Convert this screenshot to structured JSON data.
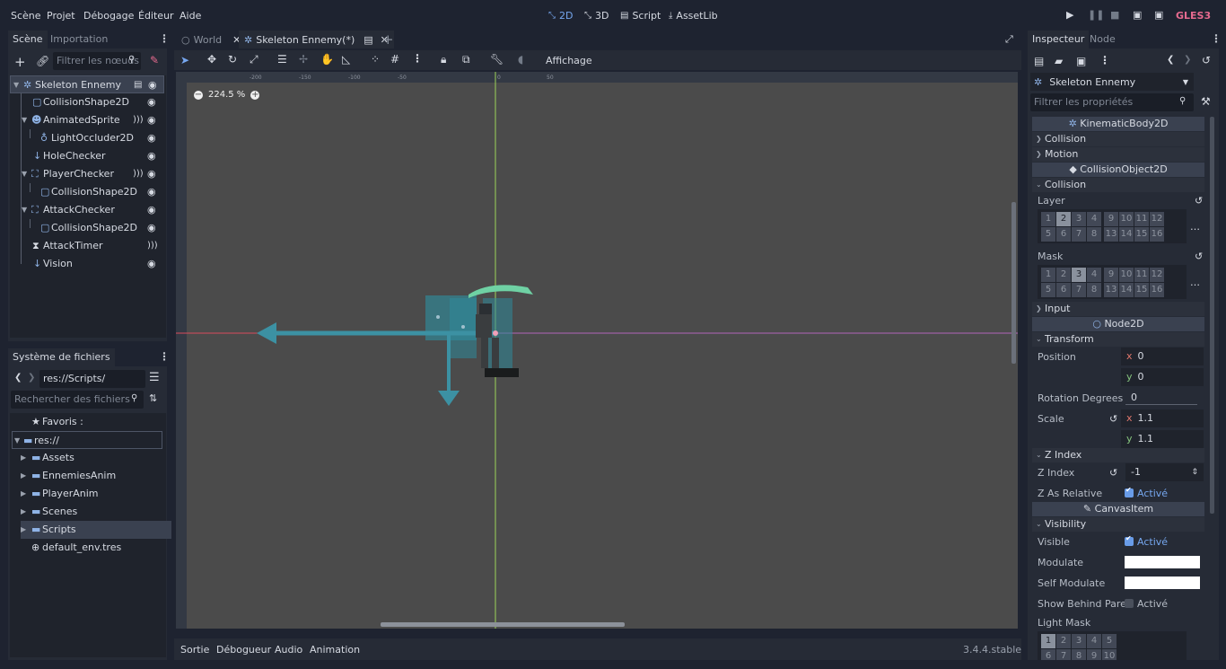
{
  "menubar": {
    "items": [
      "Scène",
      "Projet",
      "Débogage",
      "Éditeur",
      "Aide"
    ],
    "tabs": [
      {
        "label": "2D",
        "icon": "2d-icon",
        "active": true
      },
      {
        "label": "3D",
        "icon": "3d-icon",
        "active": false
      },
      {
        "label": "Script",
        "icon": "script-icon",
        "active": false
      },
      {
        "label": "AssetLib",
        "icon": "assetlib-icon",
        "active": false
      }
    ],
    "renderer": "GLES3"
  },
  "scene_dock": {
    "tabs": [
      "Scène",
      "Importation"
    ],
    "filter_placeholder": "Filtrer les nœuds",
    "nodes": [
      {
        "label": "Skeleton Ennemy",
        "icon": "kinematic-body-icon",
        "depth": 0,
        "selected": true
      },
      {
        "label": "CollisionShape2D",
        "icon": "collision-shape-icon",
        "depth": 1
      },
      {
        "label": "AnimatedSprite",
        "icon": "animated-sprite-icon",
        "depth": 1
      },
      {
        "label": "LightOccluder2D",
        "icon": "light-occluder-icon",
        "depth": 2
      },
      {
        "label": "HoleChecker",
        "icon": "raycast-icon",
        "depth": 1
      },
      {
        "label": "PlayerChecker",
        "icon": "area-icon",
        "depth": 1
      },
      {
        "label": "CollisionShape2D",
        "icon": "collision-shape-icon",
        "depth": 2
      },
      {
        "label": "AttackChecker",
        "icon": "area-icon",
        "depth": 1
      },
      {
        "label": "CollisionShape2D",
        "icon": "collision-shape-icon",
        "depth": 2
      },
      {
        "label": "AttackTimer",
        "icon": "timer-icon",
        "depth": 1
      },
      {
        "label": "Vision",
        "icon": "raycast-icon",
        "depth": 1
      }
    ]
  },
  "filesystem_dock": {
    "title": "Système de fichiers",
    "path": "res://Scripts/",
    "search_placeholder": "Rechercher des fichiers",
    "items": [
      {
        "label": "Favoris :",
        "icon": "star-icon"
      },
      {
        "label": "res://",
        "icon": "folder-icon"
      },
      {
        "label": "Assets",
        "icon": "folder-icon"
      },
      {
        "label": "EnnemiesAnim",
        "icon": "folder-icon"
      },
      {
        "label": "PlayerAnim",
        "icon": "folder-icon"
      },
      {
        "label": "Scenes",
        "icon": "folder-icon"
      },
      {
        "label": "Scripts",
        "icon": "folder-icon",
        "selected": true
      },
      {
        "label": "default_env.tres",
        "icon": "environment-icon"
      }
    ]
  },
  "editor_tabs": [
    {
      "label": "World",
      "active": false
    },
    {
      "label": "Skeleton Ennemy(*)",
      "active": true
    }
  ],
  "toolbar": {
    "view_menu": "Affichage"
  },
  "viewport": {
    "zoom": "224.5 %",
    "ruler_labels": [
      "-200",
      "-150",
      "-100",
      "-50",
      "0",
      "50"
    ]
  },
  "bottom_panel": {
    "tabs": [
      "Sortie",
      "Débogueur",
      "Audio",
      "Animation"
    ],
    "version": "3.4.4.stable"
  },
  "inspector": {
    "tabs": [
      "Inspecteur",
      "Node"
    ],
    "object": "Skeleton Ennemy",
    "filter_placeholder": "Filtrer les propriétés",
    "sections": {
      "kinematic": "KinematicBody2D",
      "collision_object": "CollisionObject2D",
      "node2d": "Node2D",
      "canvas_item": "CanvasItem"
    },
    "categories": {
      "collision": "Collision",
      "motion": "Motion",
      "collision2": "Collision",
      "input": "Input",
      "transform": "Transform",
      "z_index": "Z Index",
      "visibility": "Visibility"
    },
    "layer_label": "Layer",
    "mask_label": "Mask",
    "layer_bits": [
      "1",
      "2",
      "3",
      "4",
      "9",
      "10",
      "11",
      "12",
      "5",
      "6",
      "7",
      "8",
      "13",
      "14",
      "15",
      "16"
    ],
    "layer_on": "2",
    "mask_on": "3",
    "position_label": "Position",
    "position_x": "0",
    "position_y": "0",
    "rotation_label": "Rotation Degrees",
    "rotation_value": "0",
    "scale_label": "Scale",
    "scale_x": "1.1",
    "scale_y": "1.1",
    "z_index_label": "Z Index",
    "z_index_value": "-1",
    "z_as_relative_label": "Z As Relative",
    "active_label": "Activé",
    "visible_label": "Visible",
    "modulate_label": "Modulate",
    "self_modulate_label": "Self Modulate",
    "show_behind_label": "Show Behind Pare",
    "light_mask_label": "Light Mask",
    "light_mask_bits": [
      "1",
      "2",
      "3",
      "4",
      "5",
      "6",
      "7",
      "8",
      "9",
      "10"
    ]
  },
  "colors": {
    "accent": "#699ce8",
    "renderer": "#e66a8f",
    "x_axis": "#e0776c",
    "y_axis": "#86c47e"
  }
}
